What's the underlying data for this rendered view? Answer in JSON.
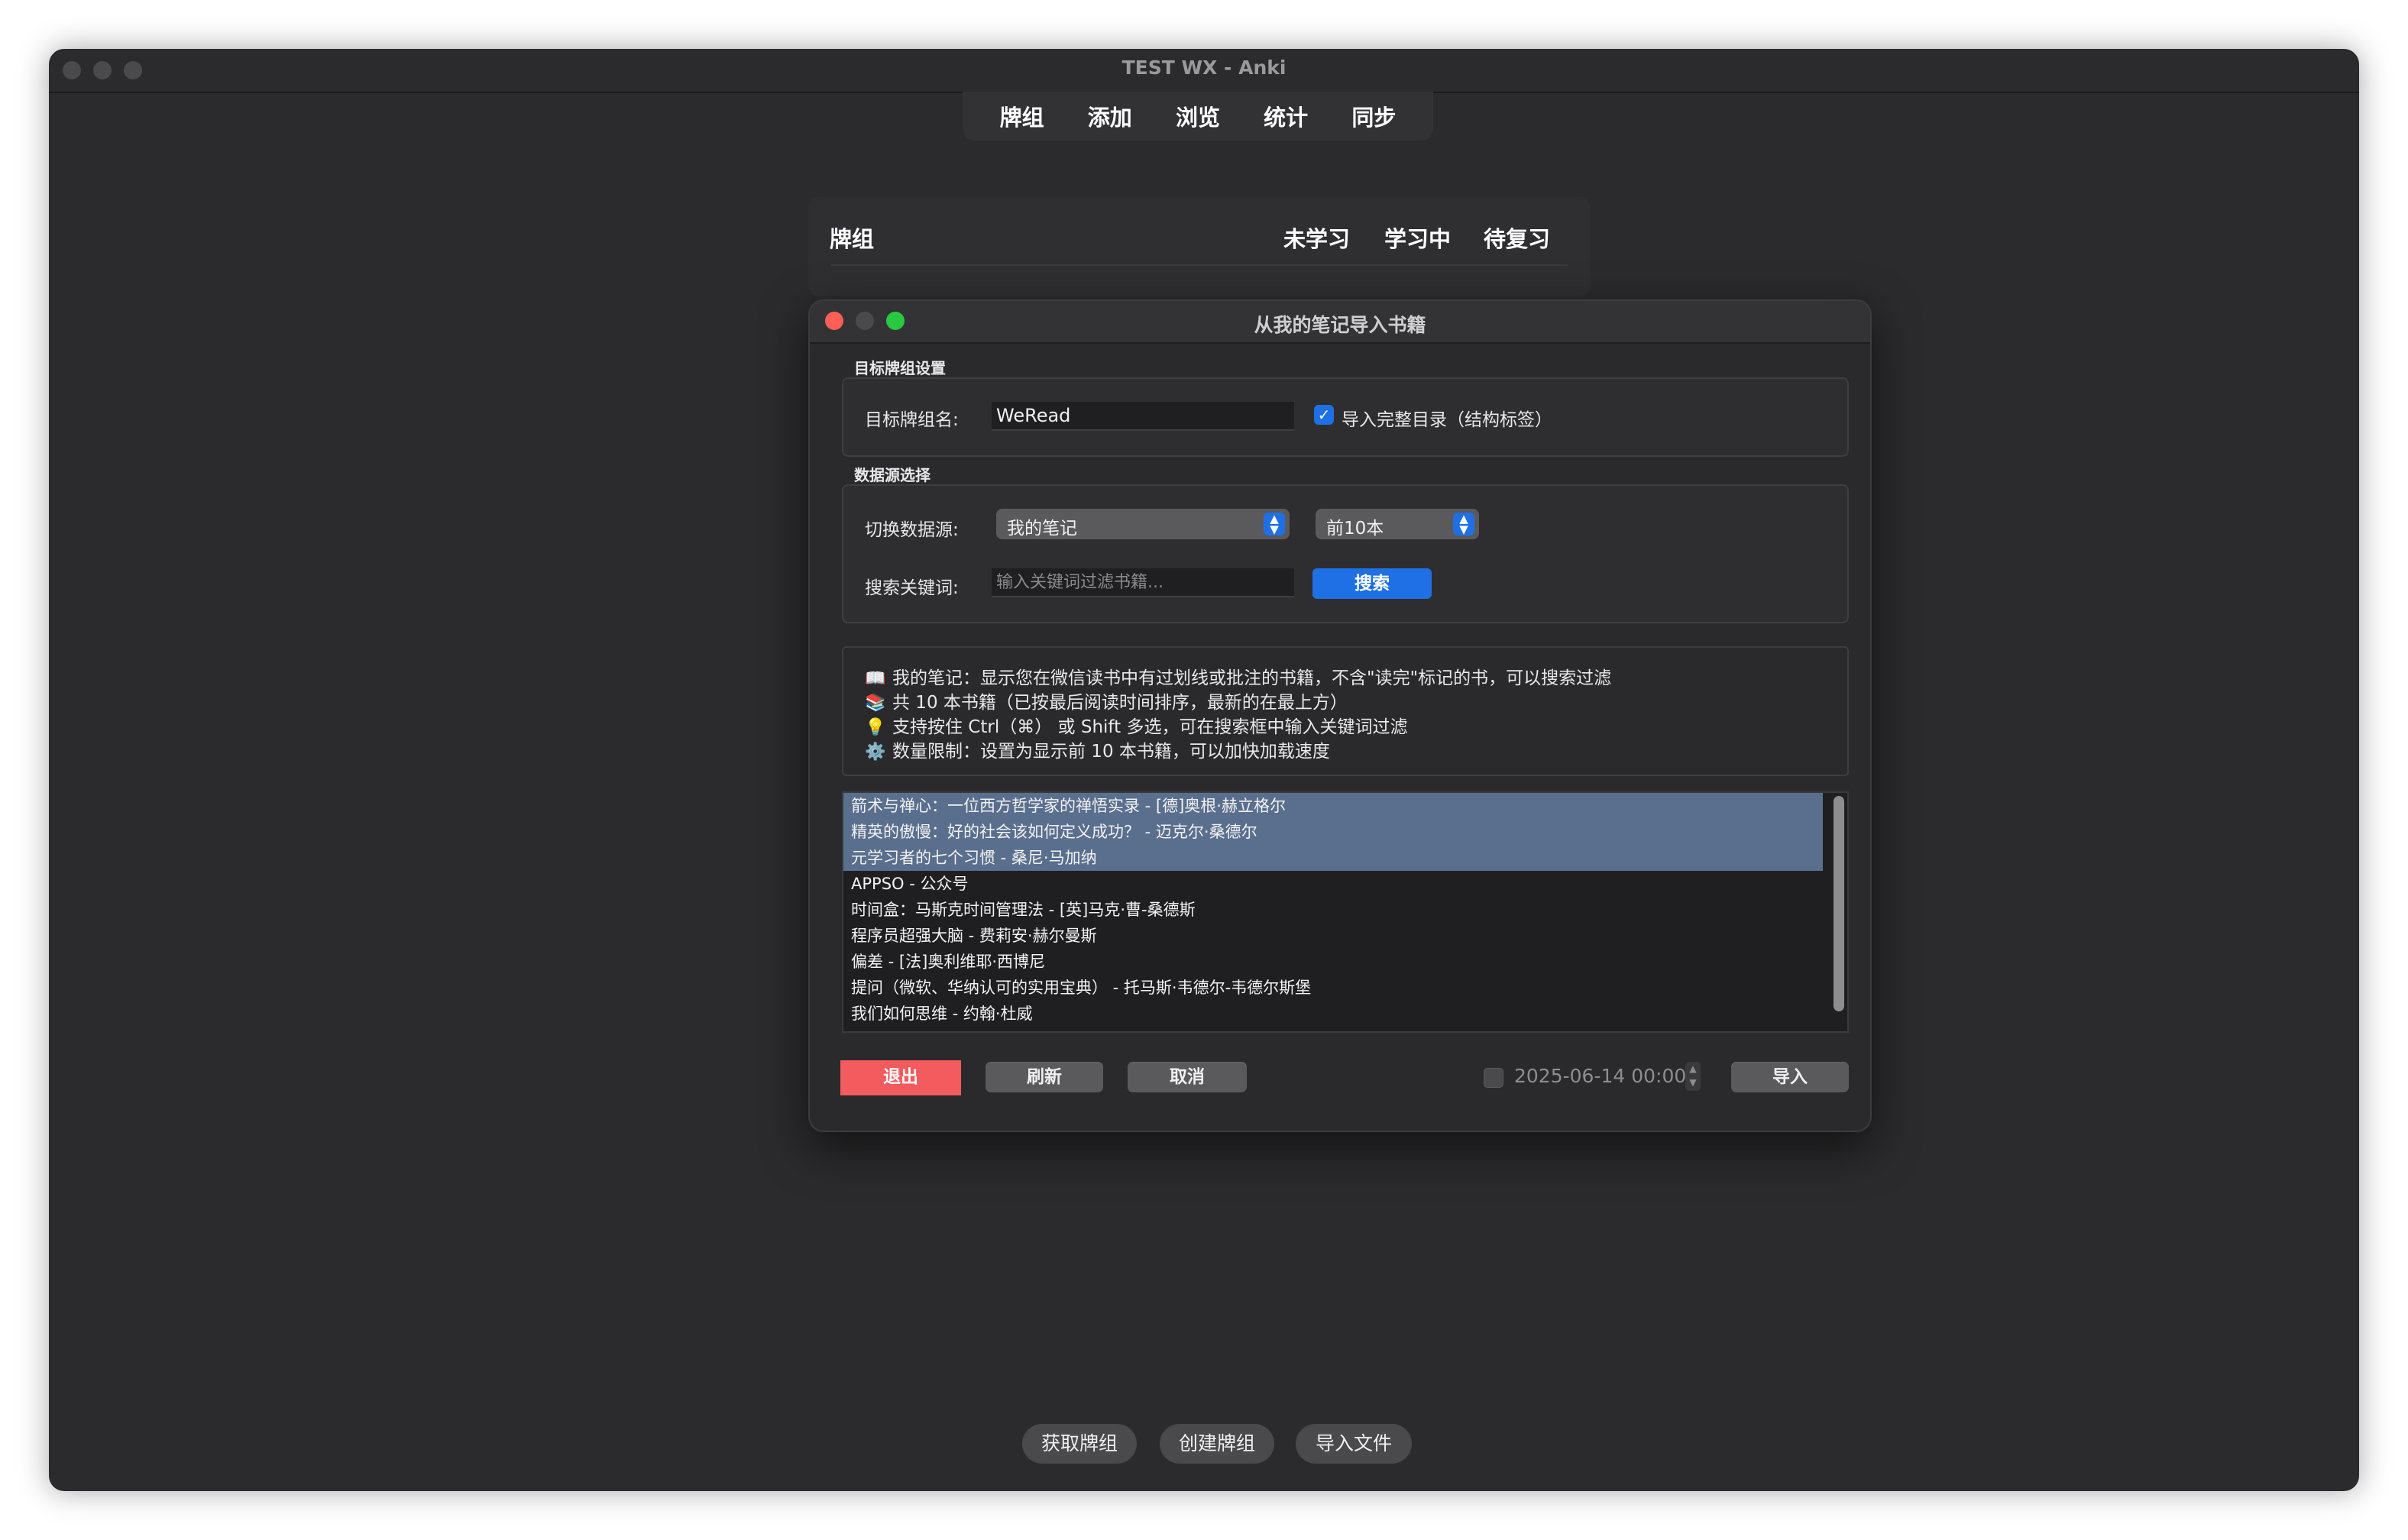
{
  "window": {
    "title": "TEST WX - Anki"
  },
  "nav": {
    "items": [
      "牌组",
      "添加",
      "浏览",
      "统计",
      "同步"
    ]
  },
  "deck_list": {
    "col_deck": "牌组",
    "col_new": "未学习",
    "col_learn": "学习中",
    "col_due": "待复习"
  },
  "dialog": {
    "title": "从我的笔记导入书籍",
    "target_section": {
      "title": "目标牌组设置",
      "deck_name_label": "目标牌组名:",
      "deck_name_value": "WeRead",
      "full_toc_label": "导入完整目录（结构标签）",
      "full_toc_checked": true
    },
    "source_section": {
      "title": "数据源选择",
      "source_label": "切换数据源:",
      "source_value": "我的笔记",
      "limit_value": "前10本",
      "keyword_label": "搜索关键词:",
      "keyword_placeholder": "输入关键词过滤书籍...",
      "search_button": "搜索"
    },
    "info": [
      {
        "icon": "📖",
        "icon_name": "book-icon",
        "text": "我的笔记：显示您在微信读书中有过划线或批注的书籍，不含\"读完\"标记的书，可以搜索过滤"
      },
      {
        "icon": "📚",
        "icon_name": "books-icon",
        "text": "共 10 本书籍（已按最后阅读时间排序，最新的在最上方）"
      },
      {
        "icon": "💡",
        "icon_name": "lightbulb-icon",
        "text": "支持按住 Ctrl（⌘） 或 Shift 多选，可在搜索框中输入关键词过滤"
      },
      {
        "icon": "⚙️",
        "icon_name": "gear-icon",
        "text": "数量限制：设置为显示前 10 本书籍，可以加快加载速度"
      }
    ],
    "books": [
      {
        "text": "箭术与禅心：一位西方哲学家的禅悟实录 - [德]奥根·赫立格尔",
        "selected": true
      },
      {
        "text": "精英的傲慢：好的社会该如何定义成功？ - 迈克尔·桑德尔",
        "selected": true
      },
      {
        "text": "元学习者的七个习惯 - 桑尼·马加纳",
        "selected": true
      },
      {
        "text": "APPSO - 公众号",
        "selected": false
      },
      {
        "text": "时间盒：马斯克时间管理法 - [英]马克·曹-桑德斯",
        "selected": false
      },
      {
        "text": "程序员超强大脑 - 费莉安·赫尔曼斯",
        "selected": false
      },
      {
        "text": "偏差 - [法]奥利维耶·西博尼",
        "selected": false
      },
      {
        "text": "提问（微软、华纳认可的实用宝典） - 托马斯·韦德尔-韦德尔斯堡",
        "selected": false
      },
      {
        "text": "我们如何思维 - 约翰·杜威",
        "selected": false
      }
    ],
    "buttons": {
      "quit": "退出",
      "refresh": "刷新",
      "cancel": "取消",
      "import": "导入"
    },
    "date_filter": {
      "checked": false,
      "value": "2025-06-14 00:00"
    }
  },
  "bottom": {
    "get_decks": "获取牌组",
    "create_deck": "创建牌组",
    "import_file": "导入文件"
  },
  "colors": {
    "accent": "#1f6fe5",
    "danger": "#f45b5f",
    "selection": "#5a6f8e",
    "window_bg": "#2b2b2d"
  }
}
